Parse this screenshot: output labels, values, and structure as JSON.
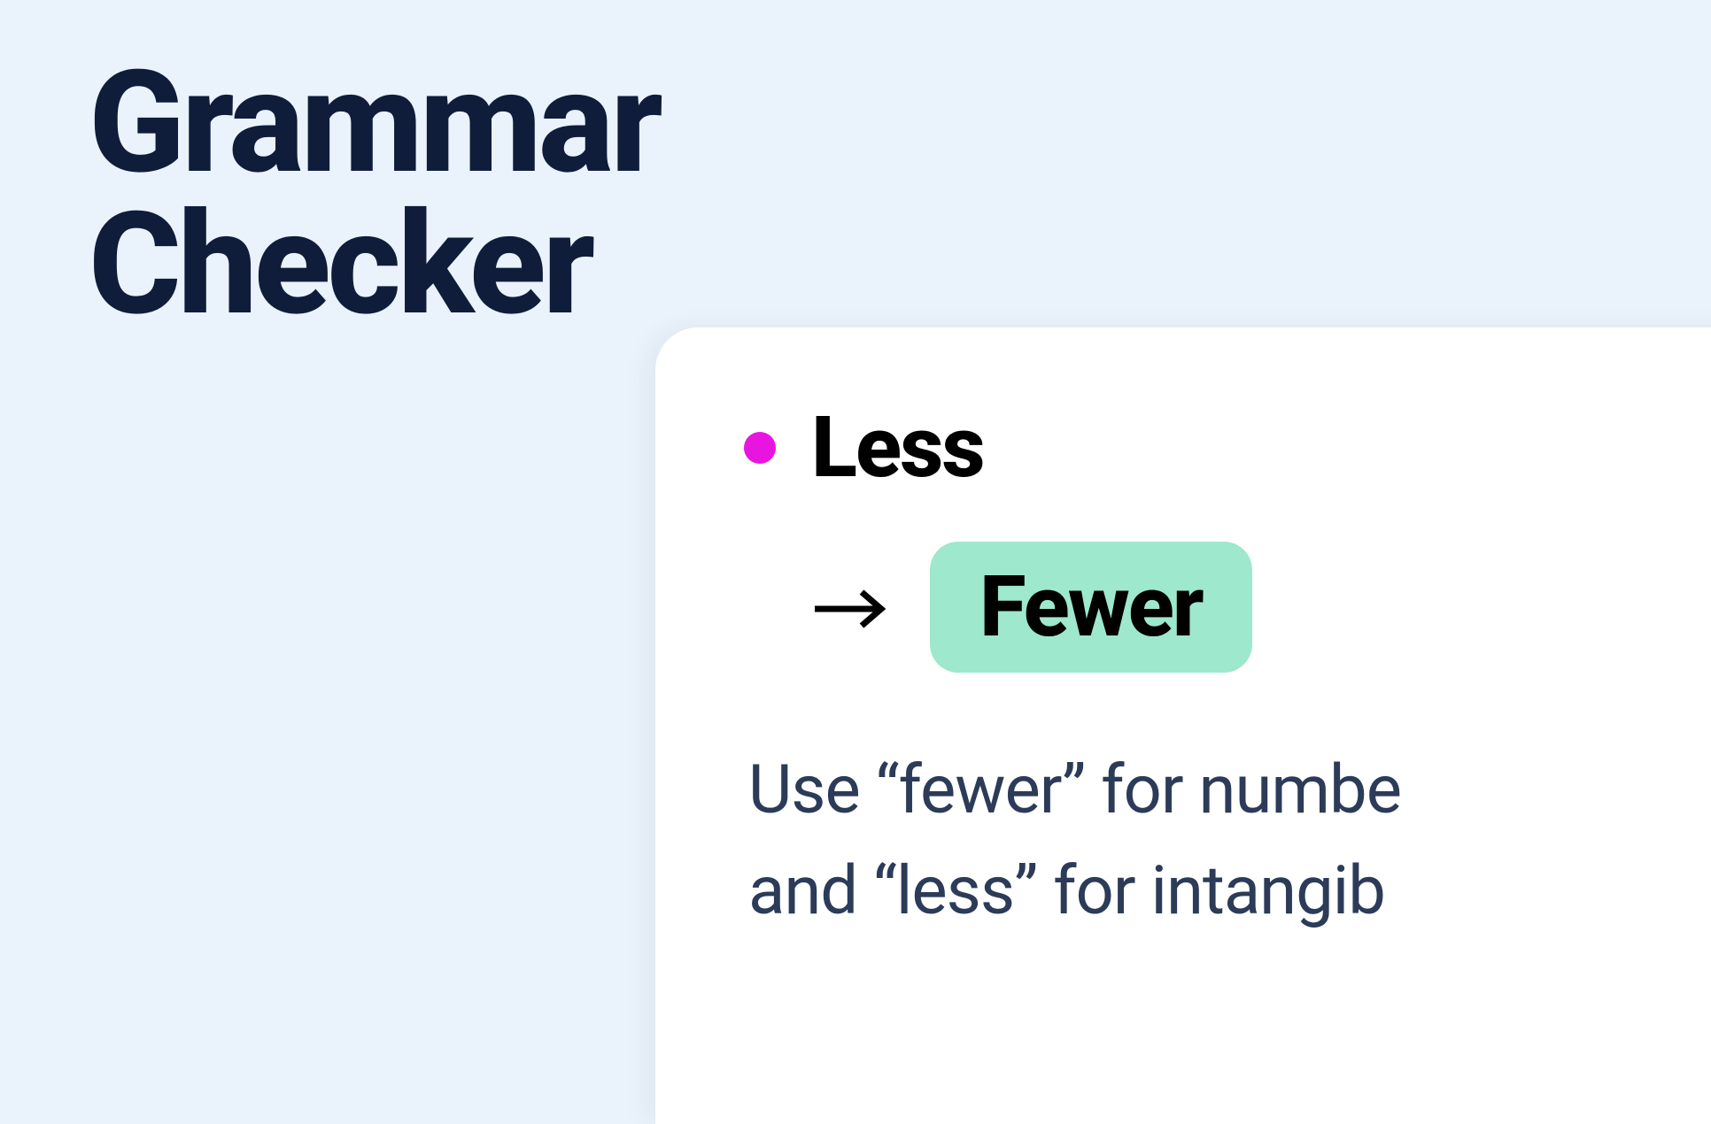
{
  "heading": {
    "line1": "Grammar",
    "line2": "Checker"
  },
  "suggestion": {
    "incorrect_word": "Less",
    "correct_word": "Fewer",
    "explanation_line1": "Use “fewer” for numbe",
    "explanation_line2": "and “less” for intangib",
    "bullet_color": "#e815e0",
    "highlight_color": "#9ee8cd"
  }
}
